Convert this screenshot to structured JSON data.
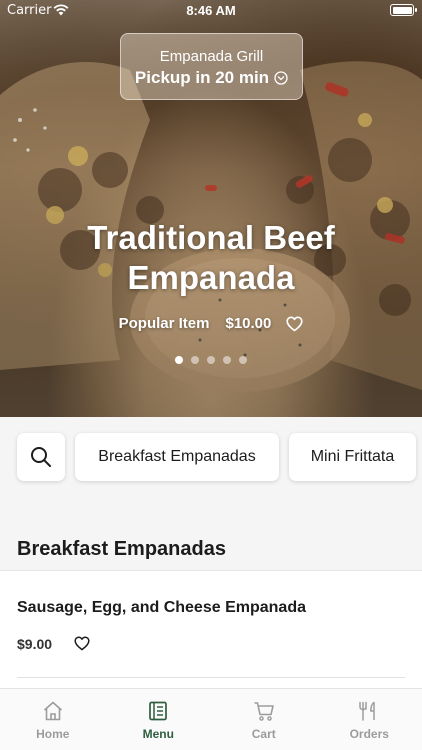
{
  "status_bar": {
    "carrier": "Carrier",
    "time": "8:46 AM"
  },
  "store": {
    "name": "Empanada Grill",
    "pickup": "Pickup in 20 min"
  },
  "hero": {
    "title_line1": "Traditional Beef",
    "title_line2": "Empanada",
    "badge": "Popular Item",
    "price": "$10.00",
    "carousel_count": 5,
    "carousel_active": 0
  },
  "categories": [
    {
      "label": "Breakfast Empanadas"
    },
    {
      "label": "Mini Frittata"
    }
  ],
  "section": {
    "title": "Breakfast Empanadas",
    "items": [
      {
        "name": "Sausage, Egg, and Cheese Empanada",
        "price": "$9.00"
      }
    ]
  },
  "tabs": [
    {
      "label": "Home",
      "icon": "home-icon"
    },
    {
      "label": "Menu",
      "icon": "menu-icon",
      "active": true
    },
    {
      "label": "Cart",
      "icon": "cart-icon"
    },
    {
      "label": "Orders",
      "icon": "orders-icon"
    }
  ],
  "colors": {
    "accent": "#2f5e3e",
    "tab_inactive": "#9c9c9c"
  }
}
